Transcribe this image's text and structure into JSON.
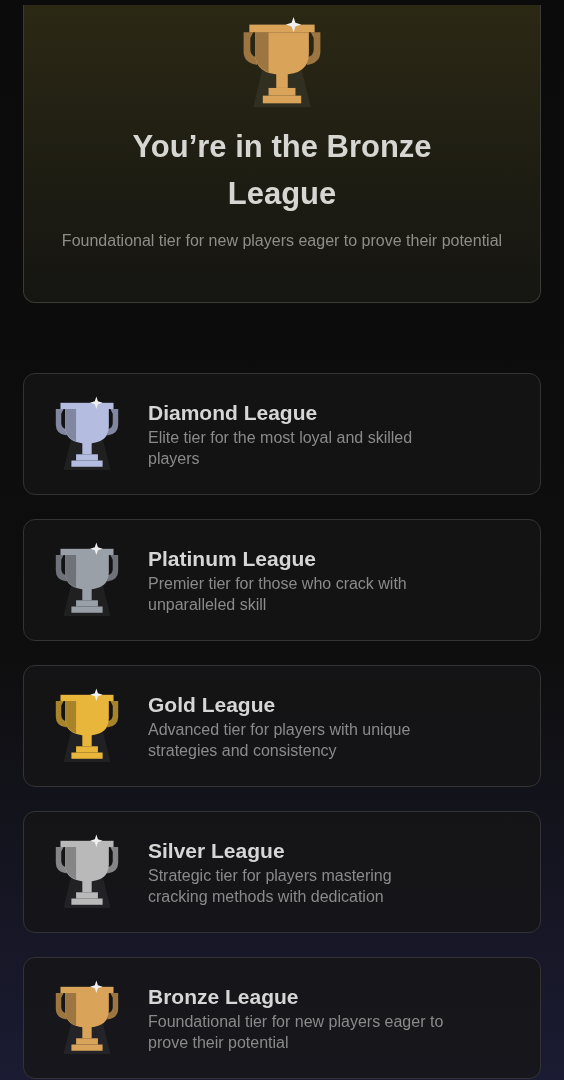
{
  "hero": {
    "title": "You’re in the Bronze League",
    "description": "Foundational tier for new players eager to prove their potential",
    "color": "#d9a35a"
  },
  "leagues": [
    {
      "name": "Diamond League",
      "description": "Elite tier for the most loyal and skilled players",
      "color": "#b4bce0"
    },
    {
      "name": "Platinum League",
      "description": "Premier tier for those who crack with unparalleled skill",
      "color": "#9aa0a8"
    },
    {
      "name": "Gold League",
      "description": "Advanced tier for players with unique strategies and consistency",
      "color": "#e8b63a"
    },
    {
      "name": "Silver League",
      "description": "Strategic tier for players mastering cracking methods with dedication",
      "color": "#b9b9b9"
    },
    {
      "name": "Bronze League",
      "description": "Foundational tier for new players eager to prove their potential",
      "color": "#d9a35a"
    }
  ]
}
